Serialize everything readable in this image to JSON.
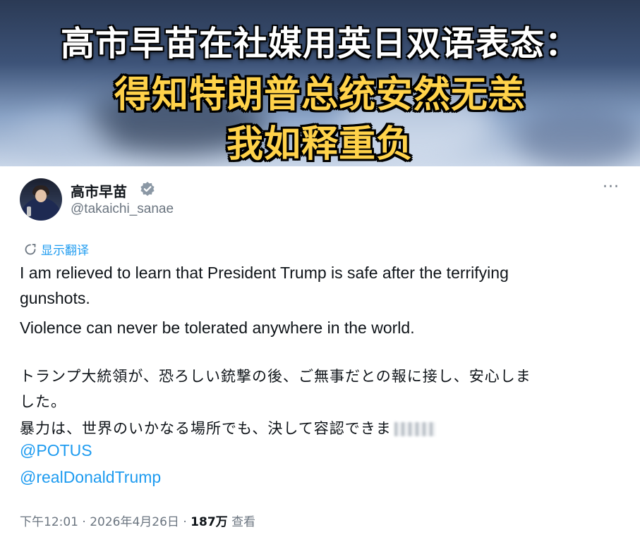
{
  "banner": {
    "line1": "高市早苗在社媒用英日双语表态：",
    "line2": "得知特朗普总统安然无恙",
    "line3": "我如释重负"
  },
  "tweet": {
    "display_name": "高市早苗",
    "handle": "@takaichi_sanae",
    "translate_label": "显示翻译",
    "body_en": [
      "I am relieved to learn that President Trump is safe after the terrifying",
      "gunshots.",
      "Violence can never be tolerated anywhere in the world."
    ],
    "body_jp": [
      "トランプ大統領が、恐ろしい銃撃の後、ご無事だとの報に接し、安心しま",
      "した。",
      "暴力は、世界のいかなる場所でも、決して容認できま"
    ],
    "mentions": [
      "@POTUS",
      "@realDonaldTrump"
    ],
    "meta": {
      "time": "下午12:01",
      "separator": " · ",
      "date": "2026年4月26日",
      "views": "187万",
      "views_label": "查看"
    }
  },
  "colors": {
    "link": "#1d9bf0",
    "banner_yellow": "#ffd24a",
    "verified_badge": "#8b98a5"
  },
  "icons": [
    "verified-badge-icon",
    "more-options-icon",
    "translate-icon"
  ]
}
